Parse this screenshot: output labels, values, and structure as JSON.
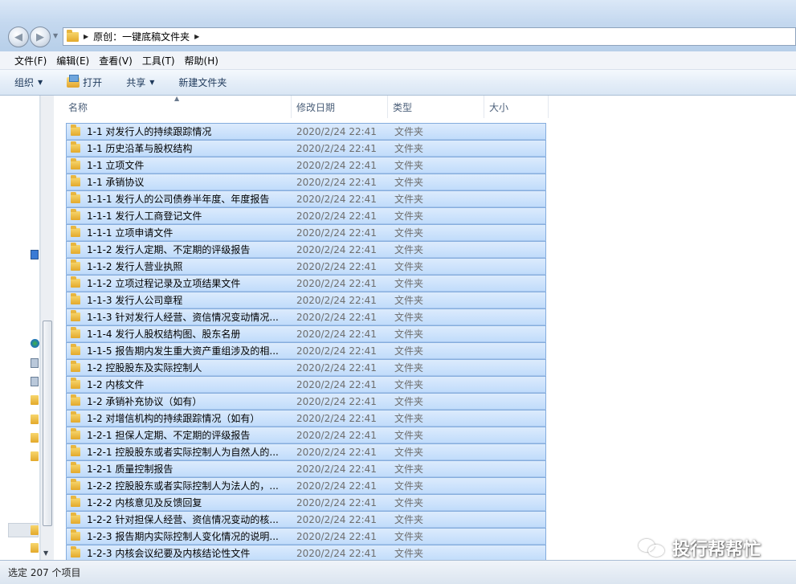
{
  "address_bar": {
    "breadcrumb": "原创：一键底稿文件夹"
  },
  "menu": [
    "文件(F)",
    "编辑(E)",
    "查看(V)",
    "工具(T)",
    "帮助(H)"
  ],
  "toolbar": {
    "organize": "组织",
    "open": "打开",
    "share": "共享",
    "new_folder": "新建文件夹"
  },
  "columns": {
    "name": "名称",
    "date": "修改日期",
    "type": "类型",
    "size": "大小"
  },
  "files": [
    {
      "name": "1-1  对发行人的持续跟踪情况",
      "date": "2020/2/24 22:41",
      "type": "文件夹"
    },
    {
      "name": "1-1  历史沿革与股权结构",
      "date": "2020/2/24 22:41",
      "type": "文件夹"
    },
    {
      "name": "1-1  立项文件",
      "date": "2020/2/24 22:41",
      "type": "文件夹"
    },
    {
      "name": "1-1 承销协议",
      "date": "2020/2/24 22:41",
      "type": "文件夹"
    },
    {
      "name": "1-1-1  发行人的公司债券半年度、年度报告",
      "date": "2020/2/24 22:41",
      "type": "文件夹"
    },
    {
      "name": "1-1-1  发行人工商登记文件",
      "date": "2020/2/24 22:41",
      "type": "文件夹"
    },
    {
      "name": "1-1-1  立项申请文件",
      "date": "2020/2/24 22:41",
      "type": "文件夹"
    },
    {
      "name": "1-1-2  发行人定期、不定期的评级报告",
      "date": "2020/2/24 22:41",
      "type": "文件夹"
    },
    {
      "name": "1-1-2  发行人营业执照",
      "date": "2020/2/24 22:41",
      "type": "文件夹"
    },
    {
      "name": "1-1-2  立项过程记录及立项结果文件",
      "date": "2020/2/24 22:41",
      "type": "文件夹"
    },
    {
      "name": "1-1-3  发行人公司章程",
      "date": "2020/2/24 22:41",
      "type": "文件夹"
    },
    {
      "name": "1-1-3  针对发行人经营、资信情况变动情况...",
      "date": "2020/2/24 22:41",
      "type": "文件夹"
    },
    {
      "name": "1-1-4  发行人股权结构图、股东名册",
      "date": "2020/2/24 22:41",
      "type": "文件夹"
    },
    {
      "name": "1-1-5  报告期内发生重大资产重组涉及的相...",
      "date": "2020/2/24 22:41",
      "type": "文件夹"
    },
    {
      "name": "1-2  控股股东及实际控制人",
      "date": "2020/2/24 22:41",
      "type": "文件夹"
    },
    {
      "name": "1-2  内核文件",
      "date": "2020/2/24 22:41",
      "type": "文件夹"
    },
    {
      "name": "1-2 承销补充协议（如有）",
      "date": "2020/2/24 22:41",
      "type": "文件夹"
    },
    {
      "name": "1-2 对增信机构的持续跟踪情况（如有）",
      "date": "2020/2/24 22:41",
      "type": "文件夹"
    },
    {
      "name": "1-2-1  担保人定期、不定期的评级报告",
      "date": "2020/2/24 22:41",
      "type": "文件夹"
    },
    {
      "name": "1-2-1  控股股东或者实际控制人为自然人的...",
      "date": "2020/2/24 22:41",
      "type": "文件夹"
    },
    {
      "name": "1-2-1  质量控制报告",
      "date": "2020/2/24 22:41",
      "type": "文件夹"
    },
    {
      "name": "1-2-2  控股股东或者实际控制人为法人的，...",
      "date": "2020/2/24 22:41",
      "type": "文件夹"
    },
    {
      "name": "1-2-2  内核意见及反馈回复",
      "date": "2020/2/24 22:41",
      "type": "文件夹"
    },
    {
      "name": "1-2-2  针对担保人经营、资信情况变动的核...",
      "date": "2020/2/24 22:41",
      "type": "文件夹"
    },
    {
      "name": "1-2-3  报告期内实际控制人变化情况的说明...",
      "date": "2020/2/24 22:41",
      "type": "文件夹"
    },
    {
      "name": "1-2-3  内核会议纪要及内核结论性文件",
      "date": "2020/2/24 22:41",
      "type": "文件夹"
    }
  ],
  "status": "选定 207 个项目",
  "watermark": "投行帮帮忙"
}
